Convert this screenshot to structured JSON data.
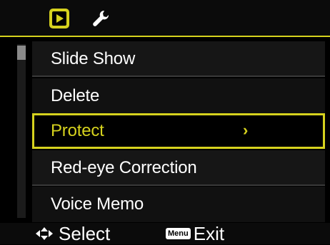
{
  "tabs": [
    {
      "icon": "playback-icon",
      "active": true
    },
    {
      "icon": "wrench-icon",
      "active": false
    }
  ],
  "accent_color": "#d6d21e",
  "menu": {
    "items": [
      {
        "label": "Slide Show"
      },
      {
        "label": "Delete"
      },
      {
        "label": "Protect",
        "selected": true,
        "submenu_indicator": "›"
      },
      {
        "label": "Red-eye Correction"
      },
      {
        "label": "Voice Memo"
      }
    ]
  },
  "footer": {
    "select_icon": "four-way-arrows-icon",
    "select_label": "Select",
    "menu_key": "Menu",
    "exit_label": "Exit"
  }
}
